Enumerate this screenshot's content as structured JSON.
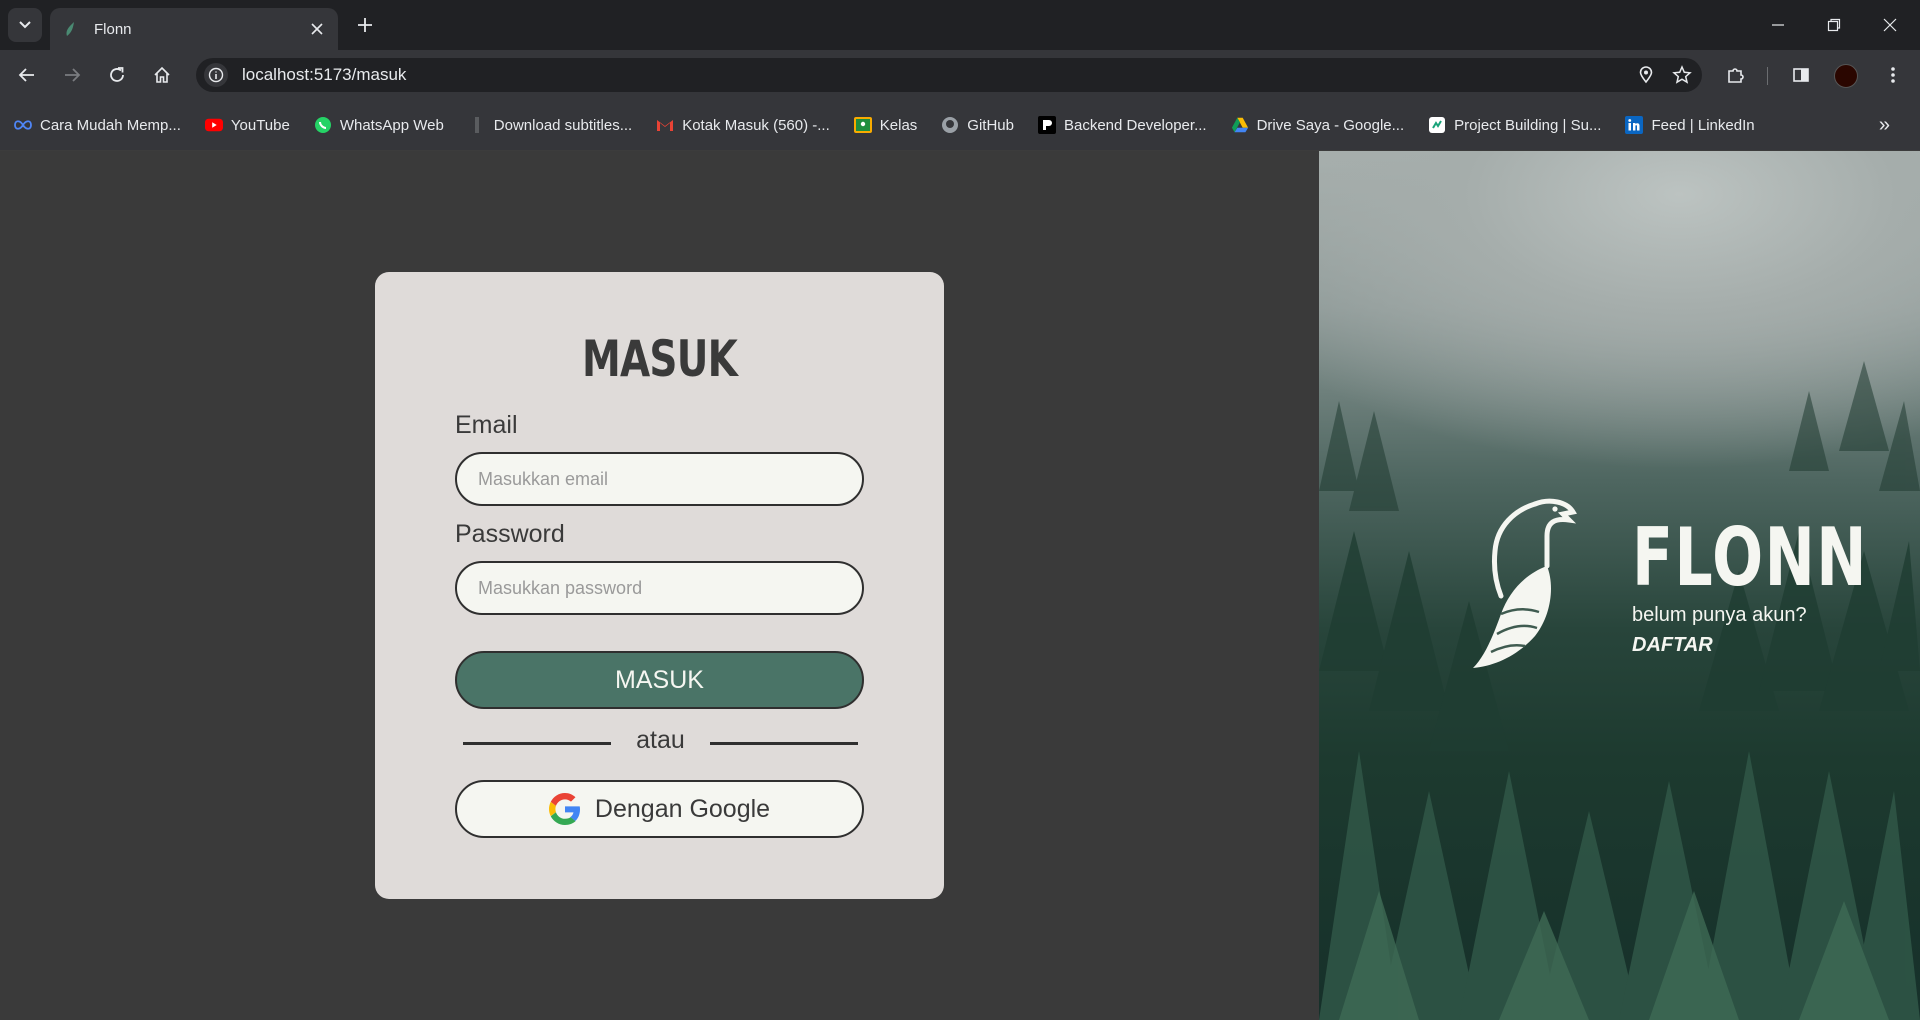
{
  "browser": {
    "tab_title": "Flonn",
    "url": "localhost:5173/masuk",
    "bookmarks": [
      {
        "label": "Cara Mudah Memp...",
        "icon": "infinity-icon"
      },
      {
        "label": "YouTube",
        "icon": "youtube-icon"
      },
      {
        "label": "WhatsApp Web",
        "icon": "whatsapp-icon"
      },
      {
        "label": "Download subtitles...",
        "icon": "bookmark-icon"
      },
      {
        "label": "Kotak Masuk (560) -...",
        "icon": "gmail-icon"
      },
      {
        "label": "Kelas",
        "icon": "classroom-icon"
      },
      {
        "label": "GitHub",
        "icon": "github-icon"
      },
      {
        "label": "Backend Developer...",
        "icon": "dicoding-icon"
      },
      {
        "label": "Drive Saya - Google...",
        "icon": "drive-icon"
      },
      {
        "label": "Project Building | Su...",
        "icon": "project-icon"
      },
      {
        "label": "Feed | LinkedIn",
        "icon": "linkedin-icon"
      }
    ],
    "more_bookmarks": "»"
  },
  "login": {
    "title": "MASUK",
    "email_label": "Email",
    "email_placeholder": "Masukkan email",
    "password_label": "Password",
    "password_placeholder": "Masukkan password",
    "submit_label": "MASUK",
    "divider_text": "atau",
    "google_label": "Dengan Google"
  },
  "hero": {
    "brand": "FLONN",
    "prompt": "belum punya akun?",
    "register_link": "DAFTAR"
  },
  "colors": {
    "accent_green": "#4a7467",
    "card_bg": "#dfdbd9",
    "page_bg": "#3a3a3a",
    "input_bg": "#f5f6f1"
  }
}
